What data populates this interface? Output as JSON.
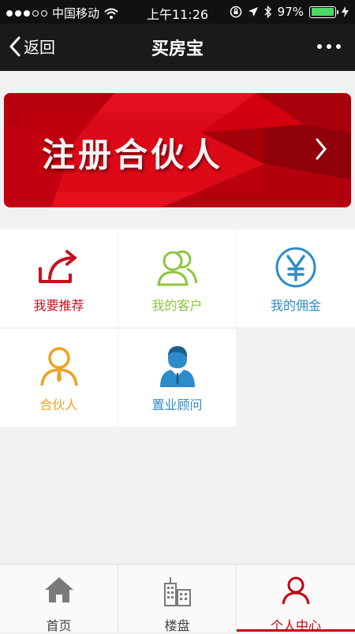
{
  "status_bar": {
    "carrier": "中国移动",
    "time": "上午11:26",
    "battery": "97%",
    "battery_level": 0.97
  },
  "nav": {
    "back_label": "返回",
    "title": "买房宝"
  },
  "banner": {
    "text": "注册合伙人"
  },
  "grid": {
    "items": [
      {
        "label": "我要推荐",
        "icon": "share-arrow-icon",
        "color": "#c8101e"
      },
      {
        "label": "我的客户",
        "icon": "customers-icon",
        "color": "#8cc63e"
      },
      {
        "label": "我的佣金",
        "icon": "yen-icon",
        "color": "#2e8bc9"
      },
      {
        "label": "合伙人",
        "icon": "partner-icon",
        "color": "#f0a020"
      },
      {
        "label": "置业顾问",
        "icon": "consultant-icon",
        "color": "#2e8bc9"
      }
    ]
  },
  "tabs": [
    {
      "label": "首页",
      "icon": "home-icon",
      "active": false
    },
    {
      "label": "楼盘",
      "icon": "buildings-icon",
      "active": false
    },
    {
      "label": "个人中心",
      "icon": "person-icon",
      "active": true
    }
  ],
  "colors": {
    "accent_red": "#c40012",
    "navbar": "#1a1a1c",
    "battery_green": "#4cd964"
  }
}
